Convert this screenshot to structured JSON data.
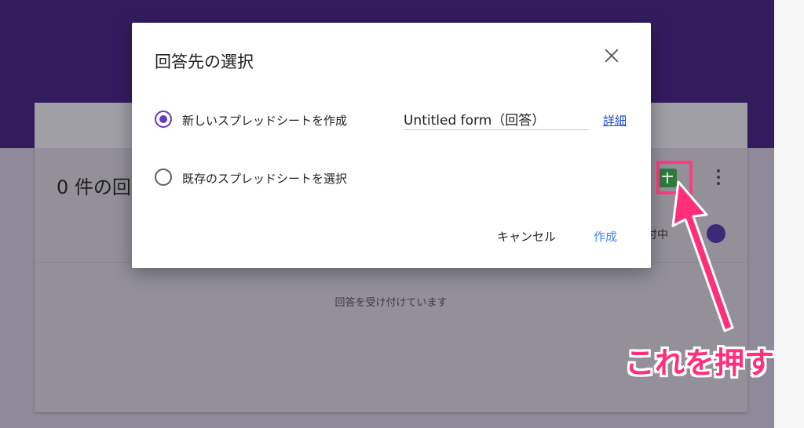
{
  "dialog": {
    "title": "回答先の選択",
    "options": [
      {
        "label": "新しいスプレッドシートを作成",
        "selected": true
      },
      {
        "label": "既存のスプレッドシートを選択",
        "selected": false
      }
    ],
    "new_sheet_name": "Untitled form（回答）",
    "details_link": "詳細",
    "cancel_label": "キャンセル",
    "create_label": "作成"
  },
  "responses_card": {
    "title": "0 件の回",
    "accepting_label": "付中",
    "empty_message": "回答を受け付けています"
  },
  "annotation": {
    "callout": "これを押す",
    "color": "#ff2f79"
  },
  "colors": {
    "header_purple": "#331c5e",
    "accent_purple": "#673ab7",
    "link_blue": "#1a47c7",
    "button_blue": "#4285f4",
    "sheets_green": "#2f7a3d"
  },
  "icons": [
    "close-icon",
    "radio-checked-icon",
    "radio-unchecked-icon",
    "sheets-icon",
    "more-vert-icon",
    "arrow-icon"
  ]
}
